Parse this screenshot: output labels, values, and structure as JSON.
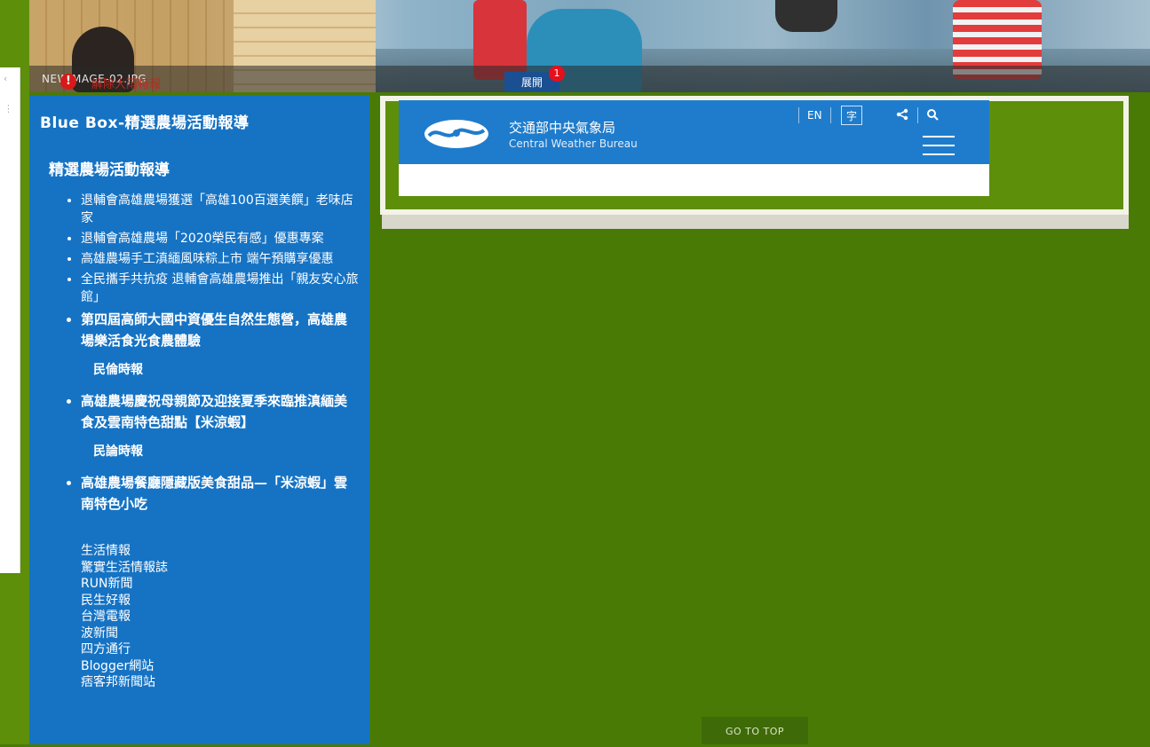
{
  "banner": {
    "caption": "NEWIMAGE-02.JPG"
  },
  "sidebar": {
    "title": "Blue Box-精選農場活動報導",
    "section_heading": "精選農場活動報導",
    "articles": [
      "退輔會高雄農場獲選「高雄100百選美饌」老味店家",
      "退輔會高雄農場「2020榮民有感」優惠專案",
      "高雄農場手工滇緬風味粽上市 端午預購享優惠",
      "全民攜手共抗疫 退輔會高雄農場推出「親友安心旅館」",
      "第四屆高師大國中資優生自然生態營，高雄農場樂活食光食農體驗"
    ],
    "source_1": "民倫時報",
    "article_6": "高雄農場慶祝母親節及迎接夏季來臨推滇緬美食及雲南特色甜點【米涼蝦】",
    "source_2": "民論時報",
    "article_7": "高雄農場餐廳隱藏版美食甜品—「米涼蝦」雲南特色小吃",
    "links": [
      "生活情報",
      "驚實生活情報誌",
      "RUN新聞",
      "民生好報",
      "台灣電報",
      "波新聞",
      "四方通行",
      "Blogger網站",
      "痞客邦新聞站"
    ]
  },
  "cwb": {
    "title": "交通部中央氣象局",
    "subtitle": "Central Weather Bureau",
    "lang_label": "EN",
    "font_label": "字",
    "alert_icon": "!",
    "alert_text": "解除大雨特報",
    "expand_label": "展開",
    "badge_count": "1"
  },
  "footer": {
    "go_top": "GO TO TOP"
  },
  "colors": {
    "sidebar": "#1673c4",
    "page_bg": "#4a7a06",
    "cwb_header": "#1f7ccc",
    "alert_red": "#c0281c"
  }
}
